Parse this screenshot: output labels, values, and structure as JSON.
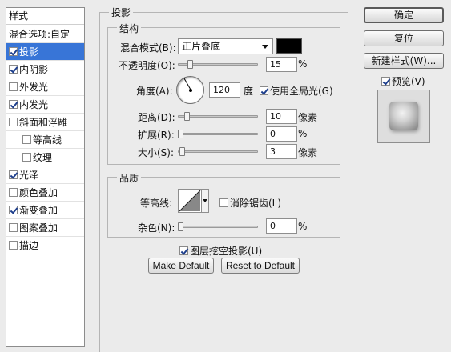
{
  "styles_panel": {
    "header": "样式",
    "blend_options": "混合选项:自定",
    "items": [
      {
        "label": "投影",
        "checked": true,
        "selected": true,
        "indent": false
      },
      {
        "label": "内阴影",
        "checked": true,
        "selected": false,
        "indent": false
      },
      {
        "label": "外发光",
        "checked": false,
        "selected": false,
        "indent": false
      },
      {
        "label": "内发光",
        "checked": true,
        "selected": false,
        "indent": false
      },
      {
        "label": "斜面和浮雕",
        "checked": false,
        "selected": false,
        "indent": false
      },
      {
        "label": "等高线",
        "checked": false,
        "selected": false,
        "indent": true
      },
      {
        "label": "纹理",
        "checked": false,
        "selected": false,
        "indent": true
      },
      {
        "label": "光泽",
        "checked": true,
        "selected": false,
        "indent": false
      },
      {
        "label": "颜色叠加",
        "checked": false,
        "selected": false,
        "indent": false
      },
      {
        "label": "渐变叠加",
        "checked": true,
        "selected": false,
        "indent": false
      },
      {
        "label": "图案叠加",
        "checked": false,
        "selected": false,
        "indent": false
      },
      {
        "label": "描边",
        "checked": false,
        "selected": false,
        "indent": false
      }
    ]
  },
  "drop_shadow": {
    "title": "投影",
    "structure": {
      "title": "结构",
      "blend_mode_label": "混合模式(B):",
      "blend_mode_value": "正片叠底",
      "shadow_color": "#000000",
      "opacity_label": "不透明度(O):",
      "opacity_value": "15",
      "opacity_unit": "%",
      "opacity_level": 0.15,
      "angle_label": "角度(A):",
      "angle_value": "120",
      "angle_unit": "度",
      "global_light_label": "使用全局光(G)",
      "global_light_checked": true,
      "distance_label": "距离(D):",
      "distance_value": "10",
      "distance_unit": "像素",
      "spread_label": "扩展(R):",
      "spread_value": "0",
      "spread_unit": "%",
      "size_label": "大小(S):",
      "size_value": "3",
      "size_unit": "像素"
    },
    "quality": {
      "title": "品质",
      "contour_label": "等高线:",
      "anti_alias_label": "消除锯齿(L)",
      "anti_alias_checked": false,
      "noise_label": "杂色(N):",
      "noise_value": "0",
      "noise_unit": "%"
    },
    "knockout_label": "图层挖空投影(U)",
    "knockout_checked": true,
    "make_default": "Make Default",
    "reset_default": "Reset to Default"
  },
  "buttons": {
    "ok": "确定",
    "reset": "复位",
    "new_style": "新建样式(W)...",
    "preview_label": "预览(V)",
    "preview_checked": true
  }
}
